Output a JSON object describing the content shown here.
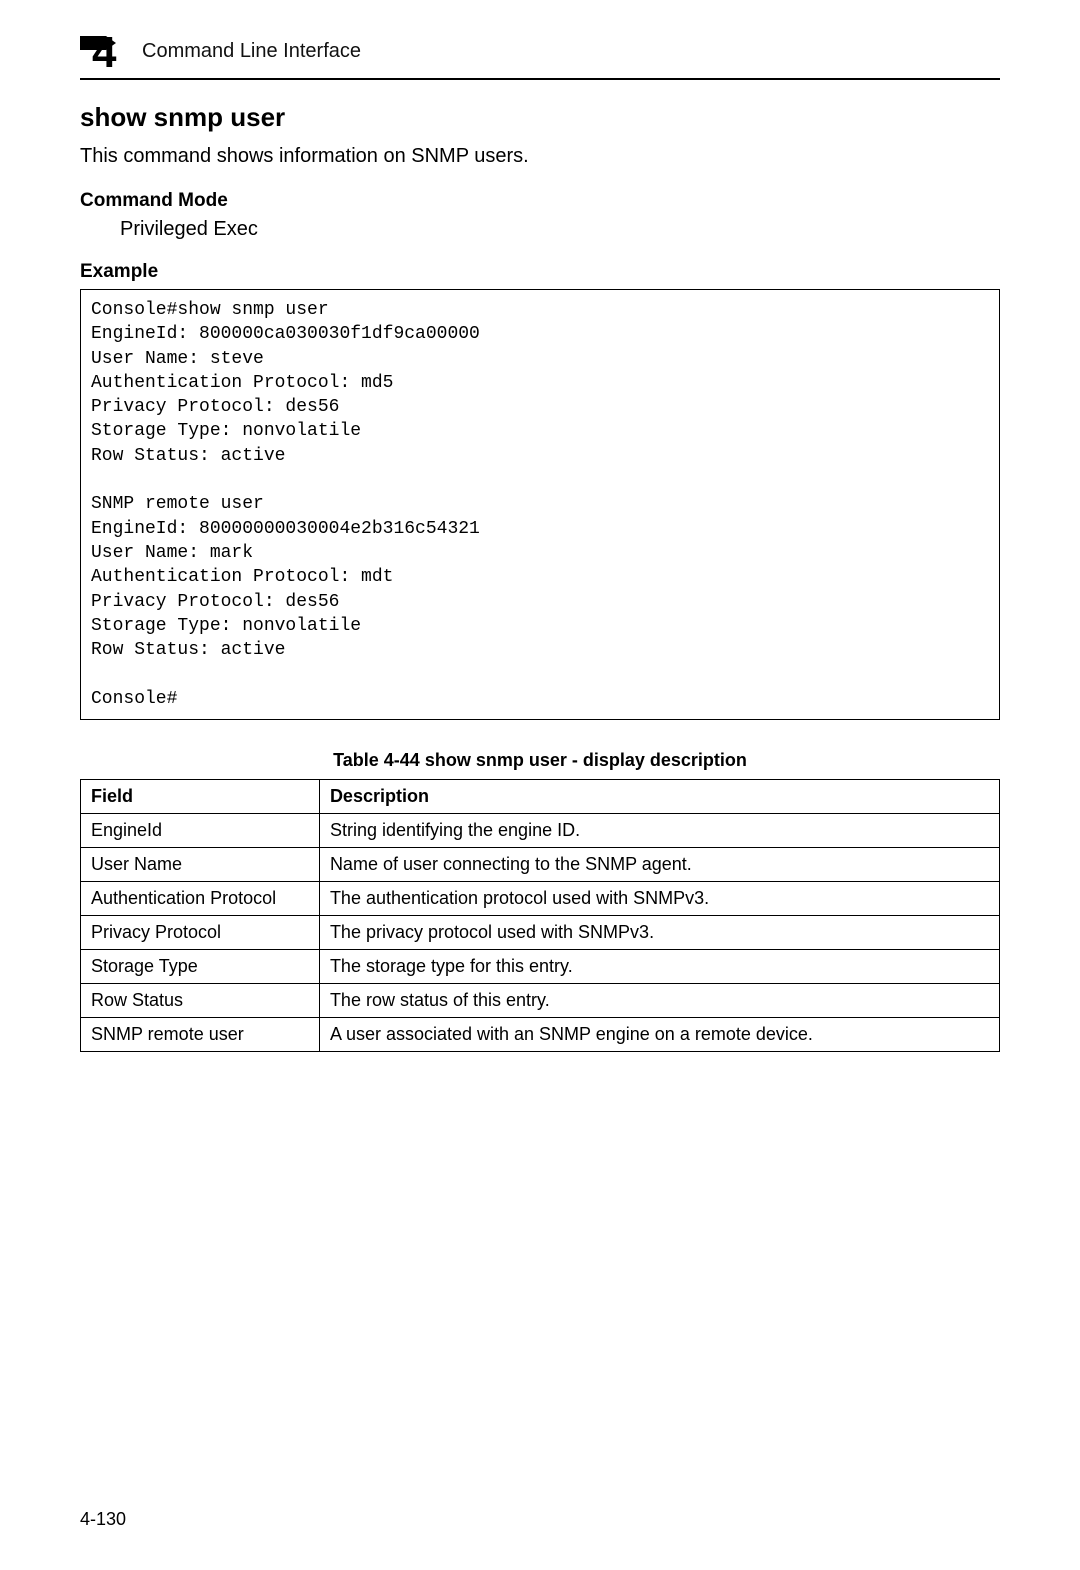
{
  "header": {
    "chapter_number": "4",
    "title": "Command Line Interface"
  },
  "section": {
    "heading": "show snmp user",
    "intro": "This command shows information on SNMP users.",
    "command_mode_label": "Command Mode",
    "command_mode_value": "Privileged Exec",
    "example_label": "Example",
    "example_code": "Console#show snmp user\nEngineId: 800000ca030030f1df9ca00000\nUser Name: steve\nAuthentication Protocol: md5\nPrivacy Protocol: des56\nStorage Type: nonvolatile\nRow Status: active\n\nSNMP remote user\nEngineId: 80000000030004e2b316c54321\nUser Name: mark\nAuthentication Protocol: mdt\nPrivacy Protocol: des56\nStorage Type: nonvolatile\nRow Status: active\n\nConsole#"
  },
  "table": {
    "caption": "Table 4-44  show snmp user - display description",
    "headers": {
      "field": "Field",
      "description": "Description"
    },
    "rows": [
      {
        "field": "EngineId",
        "description": "String identifying the engine ID."
      },
      {
        "field": "User Name",
        "description": "Name of user connecting to the SNMP agent."
      },
      {
        "field": "Authentication Protocol",
        "description": "The authentication protocol used with SNMPv3."
      },
      {
        "field": "Privacy Protocol",
        "description": "The privacy protocol used with SNMPv3."
      },
      {
        "field": "Storage Type",
        "description": "The storage type for this entry."
      },
      {
        "field": "Row Status",
        "description": "The row status of this entry."
      },
      {
        "field": "SNMP remote user",
        "description": "A user associated with an SNMP engine on a remote device."
      }
    ]
  },
  "page_number": "4-130"
}
